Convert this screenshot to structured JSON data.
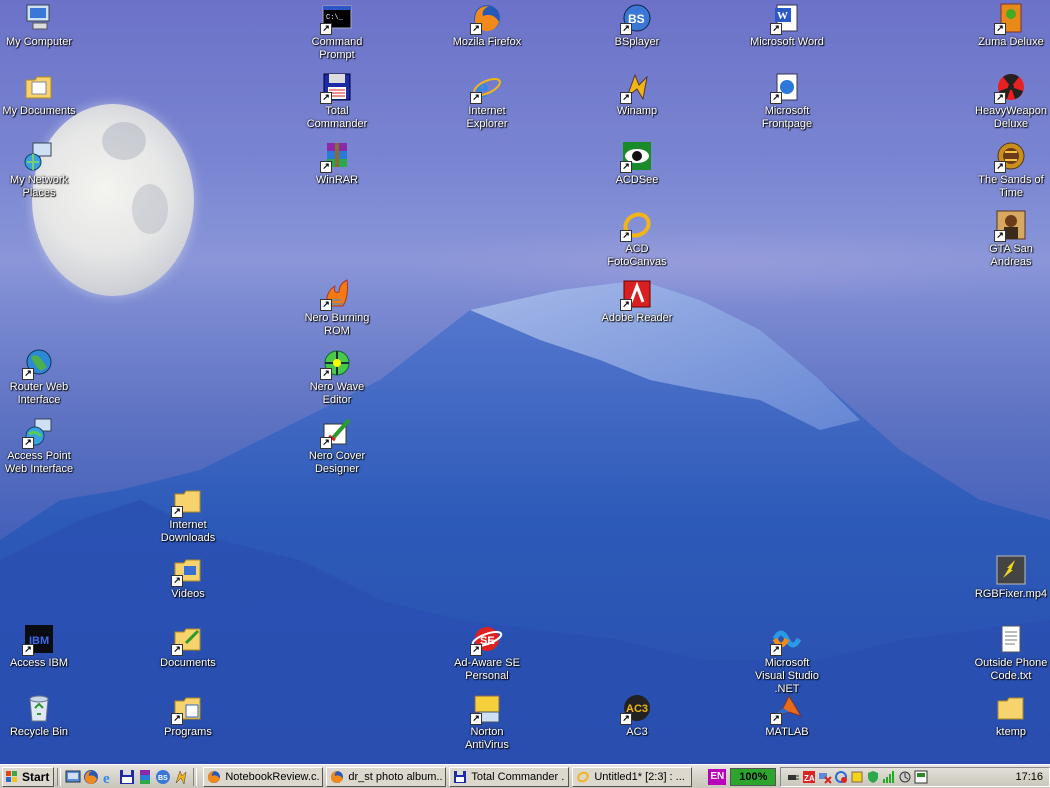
{
  "desktop": {
    "icons": [
      {
        "id": "my-computer",
        "label": "My Computer",
        "icon": "computer-icon"
      },
      {
        "id": "my-documents",
        "label": "My Documents",
        "icon": "folder-documents-icon"
      },
      {
        "id": "my-network-places",
        "label": "My Network Places",
        "icon": "network-icon"
      },
      {
        "id": "router-web-interface",
        "label": "Router Web Interface",
        "icon": "globe-icon"
      },
      {
        "id": "access-point-web-interface",
        "label": "Access Point Web Interface",
        "icon": "network-globe-icon"
      },
      {
        "id": "access-ibm",
        "label": "Access IBM",
        "icon": "ibm-icon"
      },
      {
        "id": "recycle-bin",
        "label": "Recycle Bin",
        "icon": "recycle-bin-icon"
      },
      {
        "id": "internet-downloads",
        "label": "Internet Downloads",
        "icon": "folder-icon"
      },
      {
        "id": "videos",
        "label": "Videos",
        "icon": "folder-icon"
      },
      {
        "id": "documents",
        "label": "Documents",
        "icon": "folder-icon"
      },
      {
        "id": "programs",
        "label": "Programs",
        "icon": "folder-icon"
      },
      {
        "id": "command-prompt",
        "label": "Command Prompt",
        "icon": "terminal-icon"
      },
      {
        "id": "total-commander",
        "label": "Total Commander",
        "icon": "floppy-icon"
      },
      {
        "id": "winrar",
        "label": "WinRAR",
        "icon": "archive-icon"
      },
      {
        "id": "nero-burning-rom",
        "label": "Nero Burning ROM",
        "icon": "nero-flame-icon"
      },
      {
        "id": "nero-wave-editor",
        "label": "Nero Wave Editor",
        "icon": "wave-icon"
      },
      {
        "id": "nero-cover-designer",
        "label": "Nero Cover Designer",
        "icon": "cover-designer-icon"
      },
      {
        "id": "mozilla-firefox",
        "label": "Mozila Firefox",
        "icon": "firefox-icon"
      },
      {
        "id": "internet-explorer",
        "label": "Internet Explorer",
        "icon": "internet-explorer-icon"
      },
      {
        "id": "ad-aware",
        "label": "Ad-Aware SE Personal",
        "icon": "ad-aware-icon"
      },
      {
        "id": "norton-antivirus",
        "label": "Norton AntiVirus",
        "icon": "norton-icon"
      },
      {
        "id": "bsplayer",
        "label": "BSplayer",
        "icon": "bsplayer-icon"
      },
      {
        "id": "winamp",
        "label": "Winamp",
        "icon": "winamp-icon"
      },
      {
        "id": "acdsee",
        "label": "ACDSee",
        "icon": "acdsee-eye-icon"
      },
      {
        "id": "acd-fotocanvas",
        "label": "ACD FotoCanvas",
        "icon": "fotocanvas-icon"
      },
      {
        "id": "adobe-reader",
        "label": "Adobe Reader",
        "icon": "adobe-reader-icon"
      },
      {
        "id": "ac3",
        "label": "AC3",
        "icon": "ac3-icon"
      },
      {
        "id": "microsoft-word",
        "label": "Microsoft Word",
        "icon": "word-icon"
      },
      {
        "id": "microsoft-frontpage",
        "label": "Microsoft Frontpage",
        "icon": "frontpage-icon"
      },
      {
        "id": "ms-visual-studio",
        "label": "Microsoft Visual Studio .NET",
        "icon": "visual-studio-icon"
      },
      {
        "id": "matlab",
        "label": "MATLAB",
        "icon": "matlab-icon"
      },
      {
        "id": "zuma-deluxe",
        "label": "Zuma Deluxe",
        "icon": "zuma-icon"
      },
      {
        "id": "heavyweapon-deluxe",
        "label": "HeavyWeapon Deluxe",
        "icon": "radiation-icon"
      },
      {
        "id": "sands-of-time",
        "label": "The Sands of Time",
        "icon": "sands-of-time-icon"
      },
      {
        "id": "gta-san-andreas",
        "label": "GTA San Andreas",
        "icon": "gta-icon"
      },
      {
        "id": "rgbfixer",
        "label": "RGBFixer.mp4",
        "icon": "video-file-icon"
      },
      {
        "id": "outside-phone-code",
        "label": "Outside Phone Code.txt",
        "icon": "text-file-icon"
      },
      {
        "id": "ktemp",
        "label": "ktemp",
        "icon": "folder-icon"
      }
    ]
  },
  "taskbar": {
    "start_label": "Start",
    "quick_launch": [
      "show-desktop-icon",
      "firefox-icon",
      "internet-explorer-icon",
      "total-commander-icon",
      "winrar-icon",
      "bsplayer-icon",
      "winamp-icon"
    ],
    "tasks": [
      {
        "label": "NotebookReview.c...",
        "icon": "firefox-icon"
      },
      {
        "label": "dr_st photo album...",
        "icon": "firefox-icon"
      },
      {
        "label": "Total Commander ...",
        "icon": "floppy-icon"
      },
      {
        "label": "Untitled1* [2:3] : ...",
        "icon": "fotocanvas-icon"
      }
    ],
    "language": "EN",
    "zoom": "100%",
    "tray_icons": [
      "power-icon",
      "zonealarm-icon",
      "network-disabled-icon",
      "sync-icon",
      "update-icon",
      "shield-icon",
      "signal-icon",
      "display-icon",
      "card-icon"
    ],
    "clock": "17:16"
  },
  "colors": {
    "sky": "#7a86d2",
    "mountain": "#2f52b2",
    "taskbar": "#d6d3c9",
    "lang_badge": "#b800b8",
    "zoom_badge": "#2ca52c"
  }
}
